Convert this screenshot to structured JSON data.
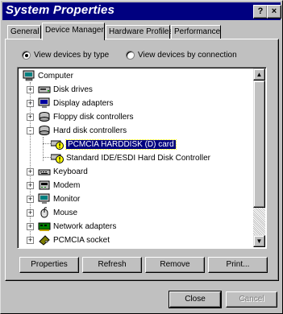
{
  "window": {
    "title": "System Properties",
    "help_glyph": "?",
    "close_glyph": "×"
  },
  "tabs": [
    "General",
    "Device Manager",
    "Hardware Profiles",
    "Performance"
  ],
  "active_tab": 1,
  "view_options": {
    "by_type": "View devices by type",
    "by_connection": "View devices by connection",
    "selected": "by_type"
  },
  "tree": {
    "root": {
      "label": "Computer",
      "icon": "computer-icon"
    },
    "items": [
      {
        "label": "Disk drives",
        "icon": "disk-drive-icon",
        "expander": "+"
      },
      {
        "label": "Display adapters",
        "icon": "display-adapter-icon",
        "expander": "+"
      },
      {
        "label": "Floppy disk controllers",
        "icon": "floppy-controller-icon",
        "expander": "+"
      },
      {
        "label": "Hard disk controllers",
        "icon": "hard-disk-controller-icon",
        "expander": "-"
      },
      {
        "label": "PCMCIA HARDDISK (D) card",
        "icon": "warning-device-icon",
        "child": true,
        "selected": true
      },
      {
        "label": "Standard IDE/ESDI Hard Disk Controller",
        "icon": "warning-device-icon",
        "child": true
      },
      {
        "label": "Keyboard",
        "icon": "keyboard-icon",
        "expander": "+"
      },
      {
        "label": "Modem",
        "icon": "modem-icon",
        "expander": "+"
      },
      {
        "label": "Monitor",
        "icon": "monitor-icon",
        "expander": "+"
      },
      {
        "label": "Mouse",
        "icon": "mouse-icon",
        "expander": "+"
      },
      {
        "label": "Network adapters",
        "icon": "network-adapter-icon",
        "expander": "+"
      },
      {
        "label": "PCMCIA socket",
        "icon": "pcmcia-socket-icon",
        "expander": "+"
      }
    ]
  },
  "actions": {
    "properties": "Properties",
    "refresh": "Refresh",
    "remove": "Remove",
    "print": "Print..."
  },
  "footer": {
    "close": "Close",
    "cancel": "Cancel"
  },
  "colors": {
    "title_bar": "#000080",
    "selection": "#000080",
    "face": "#c0c0c0"
  }
}
